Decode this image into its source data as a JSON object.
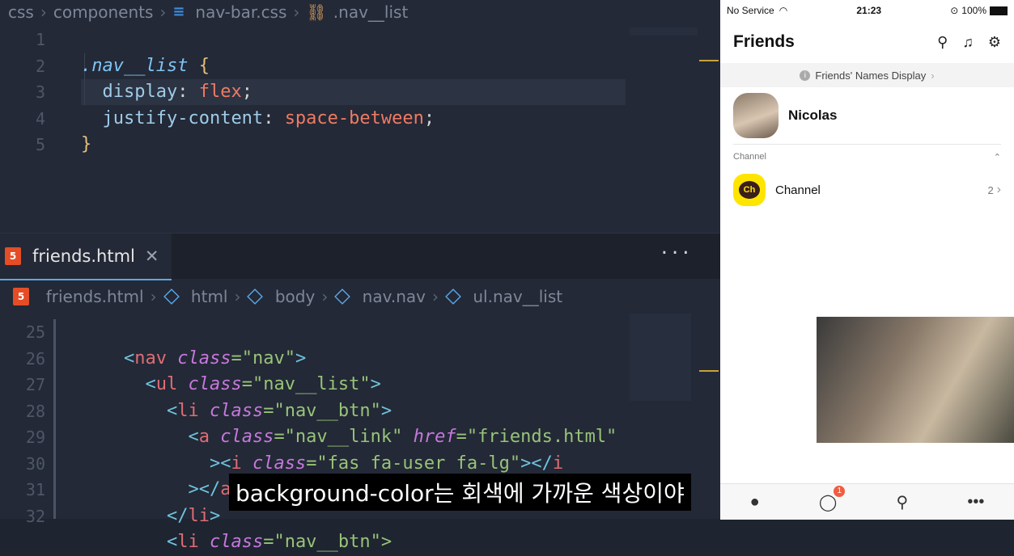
{
  "top_breadcrumb": [
    "css",
    "components",
    "nav-bar.css",
    ".nav__list"
  ],
  "css_lines": [
    "1",
    "2",
    "3",
    "4",
    "5"
  ],
  "css_code": {
    "l1_sel": ".nav__list",
    "l1_brace": "{",
    "l2_prop": "display",
    "l2_val": "flex",
    "l3_prop": "justify-content",
    "l3_val": "space-between",
    "l4_brace": "}"
  },
  "tab": {
    "label": "friends.html",
    "close": "✕",
    "more": "···"
  },
  "html_breadcrumb": [
    "friends.html",
    "html",
    "body",
    "nav.nav",
    "ul.nav__list"
  ],
  "html_lines": [
    "25",
    "26",
    "27",
    "28",
    "29",
    "30",
    "31",
    "32"
  ],
  "html_code": {
    "l25": [
      "<",
      "nav",
      "class",
      "=\"nav\"",
      ">"
    ],
    "l26": [
      "<",
      "ul",
      "class",
      "=\"nav__list\"",
      ">"
    ],
    "l27": [
      "<",
      "li",
      "class",
      "=\"nav__btn\"",
      ">"
    ],
    "l28": [
      "<",
      "a",
      "class",
      "=\"nav__link\"",
      "href",
      "=\"friends.html\""
    ],
    "l29": [
      "><",
      "i",
      "class",
      "=\"fas fa-user fa-lg\"",
      "></",
      "i"
    ],
    "l30": [
      "></",
      "a",
      ">"
    ],
    "l31": [
      "</",
      "li",
      ">"
    ],
    "l32": [
      "<",
      "li",
      "class",
      "=\"nav__btn\">"
    ]
  },
  "subtitle": "background-color는 회색에 가까운 색상이야",
  "phone": {
    "carrier": "No Service",
    "time": "21:23",
    "battery": "100%",
    "title": "Friends",
    "names_display": "Friends' Names Display",
    "me_name": "Nicolas",
    "section_channel": "Channel",
    "channel_icon_text": "Ch",
    "channel_name": "Channel",
    "channel_count": "2",
    "badge": "1"
  }
}
